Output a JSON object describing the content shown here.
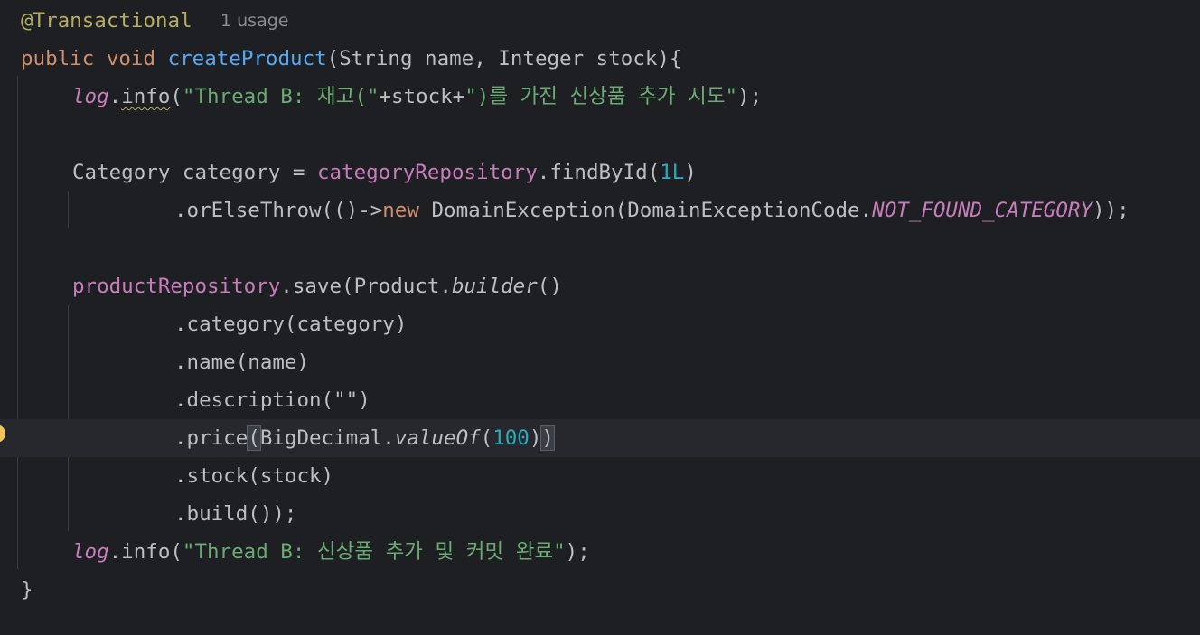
{
  "editor": {
    "annotation": "@Transactional",
    "usage_hint": "1 usage",
    "line2": {
      "kw_public": "public",
      "kw_void": "void",
      "method_name": "createProduct",
      "params": "(String name, Integer stock){"
    },
    "line3": {
      "receiver": "log",
      "dot": ".",
      "method": "info",
      "open": "(",
      "str1": "\"Thread B: 재고(\"",
      "concat": "+stock+",
      "str2": "\")를 가진 신상품 추가 시도\"",
      "close": ");"
    },
    "line5": {
      "decl": "Category category = ",
      "field": "categoryRepository",
      "call": ".findById(",
      "number": "1L",
      "close": ")"
    },
    "line6": {
      "call": ".orElseThrow(()->",
      "kw_new": "new",
      "ctor": " DomainException(DomainExceptionCode.",
      "constant": "NOT_FOUND_CATEGORY",
      "close": "));"
    },
    "line8": {
      "field": "productRepository",
      "call": ".save(Product.",
      "builder": "builder",
      "close": "()"
    },
    "line9": ".category(category)",
    "line10": ".name(name)",
    "line11": ".description(\"\")",
    "line12": {
      "call": ".price",
      "open_paren": "(",
      "class": "BigDecimal.",
      "static_method": "valueOf",
      "open": "(",
      "number": "100",
      "close_inner": ")",
      "close_paren": ")"
    },
    "line13": ".stock(stock)",
    "line14": ".build());",
    "line15": {
      "receiver": "log",
      "call": ".info(",
      "str": "\"Thread B: 신상품 추가 및 커밋 완료\"",
      "close": ");"
    },
    "line16": "}"
  },
  "colors": {
    "background": "#1e1f22",
    "current_line": "#26282e",
    "keyword": "#cf8e6d",
    "annotation": "#b3ae60",
    "method_declaration": "#56a8f5",
    "field": "#c77dbb",
    "string": "#6aab73",
    "number": "#2aacb8",
    "text": "#bcbec4",
    "hint": "#868a91",
    "intention_bulb": "#f2c55c"
  },
  "icons": {
    "gutter": "lightbulb-icon"
  }
}
